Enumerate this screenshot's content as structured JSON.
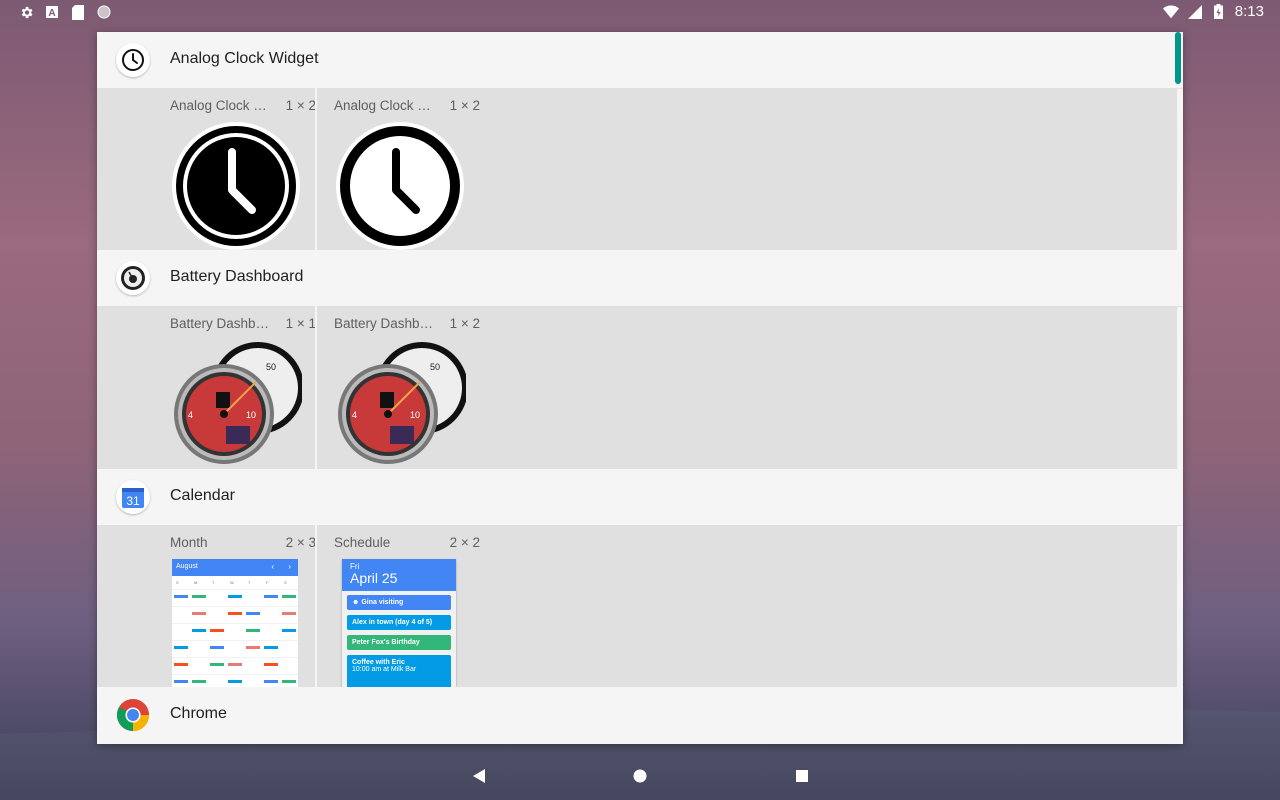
{
  "status_bar": {
    "left_icons": [
      "gear-icon",
      "a-badge-icon",
      "sd-card-icon",
      "circle-icon"
    ],
    "right_icons": [
      "wifi-icon",
      "signal-icon",
      "battery-icon"
    ],
    "time": "8:13"
  },
  "apps": [
    {
      "title": "Analog Clock Widget",
      "icon": "clock-icon",
      "widgets": [
        {
          "name": "Analog Clock Wi…",
          "size": "1 × 2",
          "preview": "analog-clock-dark"
        },
        {
          "name": "Analog Clock Wi…",
          "size": "1 × 2",
          "preview": "analog-clock-light"
        }
      ]
    },
    {
      "title": "Battery Dashboard",
      "icon": "dashboard-gauge-icon",
      "widgets": [
        {
          "name": "Battery Dashboa…",
          "size": "1 × 1",
          "preview": "battery-gauge"
        },
        {
          "name": "Battery Dashboa…",
          "size": "1 × 2",
          "preview": "battery-gauge"
        }
      ]
    },
    {
      "title": "Calendar",
      "icon": "calendar-31-icon",
      "icon_text": "31",
      "widgets": [
        {
          "name": "Month",
          "size": "2 × 3",
          "preview": "calendar-month"
        },
        {
          "name": "Schedule",
          "size": "2 × 2",
          "preview": "calendar-schedule"
        }
      ]
    },
    {
      "title": "Chrome",
      "icon": "chrome-icon",
      "widgets": []
    }
  ],
  "calendar_month": {
    "month": "August",
    "weekdays": [
      "S",
      "M",
      "T",
      "W",
      "T",
      "F",
      "S"
    ]
  },
  "calendar_schedule": {
    "day": "Fri",
    "date": "April 25",
    "events": [
      {
        "title": "Gina visiting",
        "color": "#4285f4"
      },
      {
        "title": "Alex in town (day 4 of 5)",
        "color": "#039be5"
      },
      {
        "title": "Peter Fox's Birthday",
        "color": "#33b679"
      },
      {
        "title": "Coffee with Eric",
        "sub": "10:00 am at Milk Bar",
        "color": "#039be5"
      }
    ]
  },
  "nav": [
    "back-icon",
    "home-icon",
    "recents-icon"
  ],
  "colors": {
    "accent": "#009688",
    "calendar_blue": "#4285f4"
  }
}
